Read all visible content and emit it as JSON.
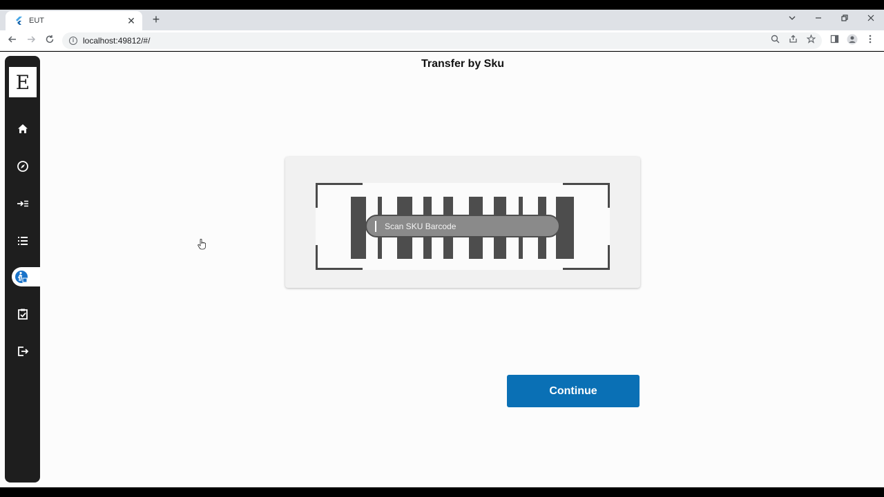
{
  "browser": {
    "tab_title": "EUT",
    "tab_close": "✕",
    "new_tab": "+",
    "url": "localhost:49812/#/",
    "window_controls": [
      "⌵",
      "—",
      "❐",
      "✕"
    ]
  },
  "sidebar": {
    "logo_letter": "E",
    "items": [
      {
        "name": "home-icon",
        "active": false
      },
      {
        "name": "compass-icon",
        "active": false
      },
      {
        "name": "transfer-in-icon",
        "active": false
      },
      {
        "name": "list-icon",
        "active": false
      },
      {
        "name": "person-transfer-icon",
        "active": true
      },
      {
        "name": "clipboard-check-icon",
        "active": false
      },
      {
        "name": "logout-icon",
        "active": false
      }
    ]
  },
  "page": {
    "title": "Transfer by Sku"
  },
  "scanner": {
    "placeholder": "Scan SKU Barcode"
  },
  "actions": {
    "continue_label": "Continue"
  },
  "colors": {
    "accent": "#0a70b5",
    "sidebar_bg": "#1e1e1e",
    "active_icon": "#1a73c9"
  }
}
